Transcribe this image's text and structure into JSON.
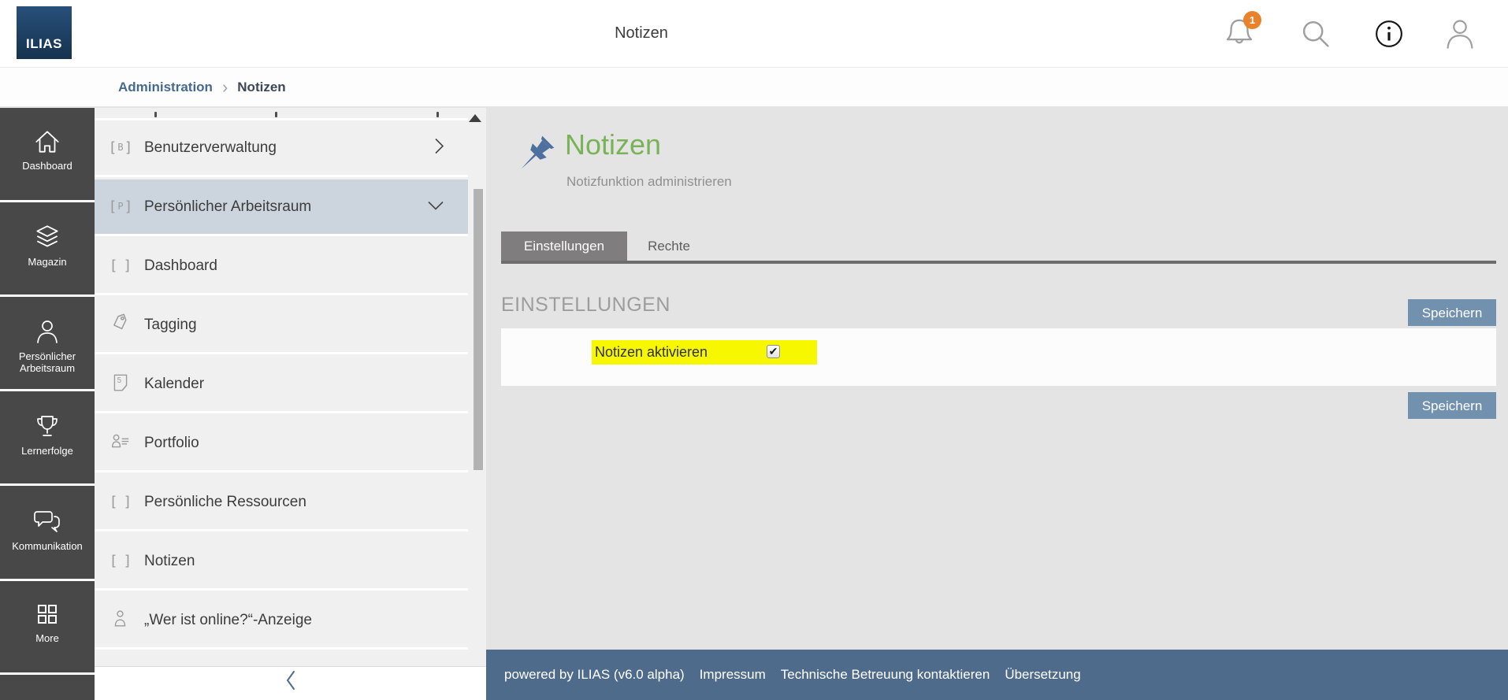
{
  "header": {
    "logo": "ILIAS",
    "title": "Notizen",
    "notification_count": "1"
  },
  "breadcrumb": {
    "items": [
      {
        "label": "Administration"
      },
      {
        "label": "Notizen"
      }
    ]
  },
  "mainbar": {
    "items": [
      {
        "label": "Dashboard",
        "icon": "home-icon"
      },
      {
        "label": "Magazin",
        "icon": "layers-icon"
      },
      {
        "label": "Persönlicher Arbeitsraum",
        "icon": "user-icon"
      },
      {
        "label": "Lernerfolge",
        "icon": "trophy-icon"
      },
      {
        "label": "Kommunikation",
        "icon": "chat-icon"
      },
      {
        "label": "More",
        "icon": "grid-icon"
      }
    ]
  },
  "sidebar": {
    "items": [
      {
        "label": "Benutzerverwaltung",
        "icon": "bracket-b-icon",
        "chevron": "right",
        "selected": false
      },
      {
        "label": "Persönlicher Arbeitsraum",
        "icon": "bracket-p-icon",
        "chevron": "down",
        "selected": true
      },
      {
        "label": "Dashboard",
        "icon": "bracket-empty-icon",
        "selected": false
      },
      {
        "label": "Tagging",
        "icon": "tag-icon",
        "selected": false
      },
      {
        "label": "Kalender",
        "icon": "calendar-icon",
        "selected": false
      },
      {
        "label": "Portfolio",
        "icon": "portfolio-icon",
        "selected": false
      },
      {
        "label": "Persönliche Ressourcen",
        "icon": "bracket-empty-icon",
        "selected": false
      },
      {
        "label": "Notizen",
        "icon": "bracket-empty-icon",
        "selected": false
      },
      {
        "label": "„Wer ist online?“-Anzeige",
        "icon": "person-icon",
        "selected": false
      }
    ]
  },
  "content": {
    "page_title": "Notizen",
    "page_subtitle": "Notizfunktion administrieren",
    "tabs": [
      {
        "label": "Einstellungen",
        "active": true
      },
      {
        "label": "Rechte",
        "active": false
      }
    ],
    "section_title": "EINSTELLUNGEN",
    "save_button": "Speichern",
    "form": {
      "setting_label": "Notizen aktivieren",
      "checkbox_checked": true
    }
  },
  "footer": {
    "powered_by": "powered by ILIAS (v6.0 alpha)",
    "links": [
      "Impressum",
      "Technische Betreuung kontaktieren",
      "Übersetzung"
    ]
  },
  "icons": {
    "check": "✔",
    "breadcrumb_separator": "›"
  },
  "colors": {
    "accent_green": "#79b356",
    "button_blue": "#7191ae",
    "footer_blue": "#4f6b8c",
    "highlight_yellow": "#f7f700",
    "badge_orange": "#e8822b",
    "selected_item": "#ccd5de",
    "mainbar_dark": "#484848"
  }
}
